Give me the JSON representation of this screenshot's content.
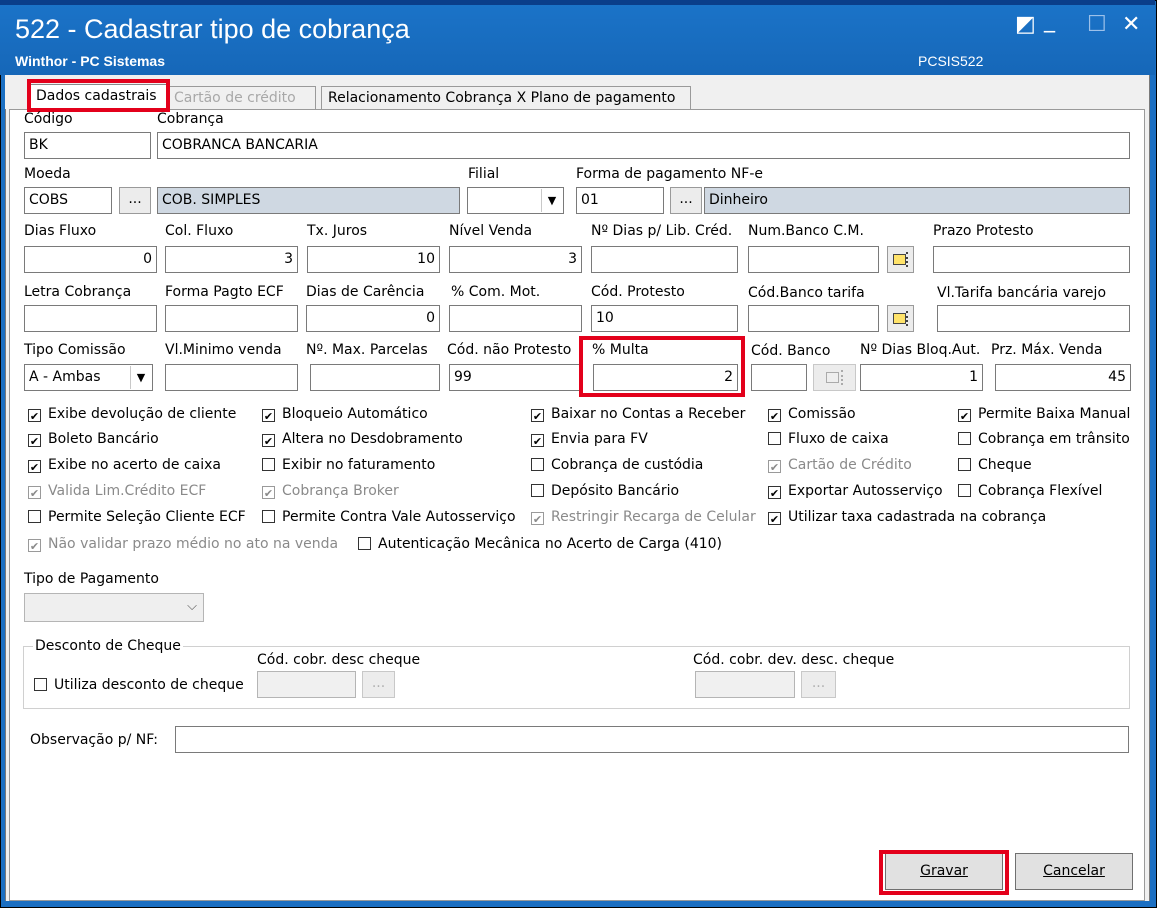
{
  "window": {
    "title": "522 - Cadastrar tipo de cobrança",
    "subtitle": "Winthor - PC Sistemas",
    "code": "PCSIS522",
    "controls": {
      "restore": "◩",
      "minimize": "_",
      "maximize": "☐",
      "close": "✕"
    }
  },
  "tabs": [
    {
      "label": "Dados cadastrais",
      "state": "active"
    },
    {
      "label": "Cartão de crédito",
      "state": "disabled"
    },
    {
      "label": "Relacionamento Cobrança X Plano de pagamento",
      "state": "normal"
    }
  ],
  "fields": {
    "codigo": {
      "label": "Código",
      "value": "BK"
    },
    "cobranca": {
      "label": "Cobrança",
      "value": "COBRANCA BANCARIA"
    },
    "moeda": {
      "label": "Moeda",
      "value": "COBS",
      "desc": "COB. SIMPLES",
      "lookup": "..."
    },
    "filial": {
      "label": "Filial",
      "value": ""
    },
    "forma_pag_nfe": {
      "label": "Forma de pagamento NF-e",
      "value": "01",
      "desc": "Dinheiro",
      "lookup": "..."
    },
    "dias_fluxo": {
      "label": "Dias Fluxo",
      "value": "0"
    },
    "col_fluxo": {
      "label": "Col. Fluxo",
      "value": "3"
    },
    "tx_juros": {
      "label": "Tx. Juros",
      "value": "10"
    },
    "nivel_venda": {
      "label": "Nível Venda",
      "value": "3"
    },
    "dias_lib_cred": {
      "label": "Nº Dias p/ Lib. Créd.",
      "value": ""
    },
    "num_banco_cm": {
      "label": "Num.Banco C.M.",
      "value": ""
    },
    "prazo_protesto": {
      "label": "Prazo Protesto",
      "value": ""
    },
    "letra_cobranca": {
      "label": "Letra Cobrança",
      "value": ""
    },
    "forma_pagto_ecf": {
      "label": "Forma Pagto ECF",
      "value": ""
    },
    "dias_carencia": {
      "label": "Dias de Carência",
      "value": "0"
    },
    "com_mot": {
      "label": "% Com. Mot.",
      "value": ""
    },
    "cod_protesto": {
      "label": "Cód. Protesto",
      "value": "10"
    },
    "cod_banco_tarifa": {
      "label": "Cód.Banco tarifa",
      "value": ""
    },
    "vl_tarifa": {
      "label": "Vl.Tarifa bancária varejo",
      "value": ""
    },
    "tipo_comissao": {
      "label": "Tipo Comissão",
      "value": "A - Ambas"
    },
    "vl_minimo_venda": {
      "label": "Vl.Minimo venda",
      "value": ""
    },
    "max_parcelas": {
      "label": "Nº. Max. Parcelas",
      "value": ""
    },
    "cod_nao_protesto": {
      "label": "Cód. não Protesto",
      "value": "99"
    },
    "multa": {
      "label": "% Multa",
      "value": "2"
    },
    "cod_banco": {
      "label": "Cód. Banco",
      "value": ""
    },
    "dias_bloq_aut": {
      "label": "Nº Dias Bloq.Aut.",
      "value": "1"
    },
    "prz_max_venda": {
      "label": "Prz. Máx. Venda",
      "value": "45"
    }
  },
  "checkboxes": [
    {
      "label": "Exibe devolução de cliente",
      "checked": true,
      "disabled": false
    },
    {
      "label": "Boleto Bancário",
      "checked": true,
      "disabled": false
    },
    {
      "label": "Exibe no acerto de caixa",
      "checked": true,
      "disabled": false
    },
    {
      "label": "Valida Lim.Crédito ECF",
      "checked": true,
      "disabled": true
    },
    {
      "label": "Permite Seleção Cliente ECF",
      "checked": false,
      "disabled": false
    },
    {
      "label": "Não validar prazo médio no ato na venda",
      "checked": true,
      "disabled": true
    },
    {
      "label": "Bloqueio Automático",
      "checked": true,
      "disabled": false
    },
    {
      "label": "Altera no Desdobramento",
      "checked": true,
      "disabled": false
    },
    {
      "label": "Exibir no faturamento",
      "checked": false,
      "disabled": false
    },
    {
      "label": "Cobrança Broker",
      "checked": true,
      "disabled": true
    },
    {
      "label": "Permite Contra Vale Autosserviço",
      "checked": false,
      "disabled": false
    },
    {
      "label": "Autenticação Mecânica no Acerto de Carga (410)",
      "checked": false,
      "disabled": false
    },
    {
      "label": "Baixar no Contas a Receber",
      "checked": true,
      "disabled": false
    },
    {
      "label": "Envia para FV",
      "checked": true,
      "disabled": false
    },
    {
      "label": "Cobrança de custódia",
      "checked": false,
      "disabled": false
    },
    {
      "label": "Depósito Bancário",
      "checked": false,
      "disabled": false
    },
    {
      "label": "Restringir Recarga de Celular",
      "checked": true,
      "disabled": true
    },
    {
      "label": "Comissão",
      "checked": true,
      "disabled": false
    },
    {
      "label": "Fluxo de caixa",
      "checked": false,
      "disabled": false
    },
    {
      "label": "Cartão de Crédito",
      "checked": true,
      "disabled": true
    },
    {
      "label": "Exportar Autosserviço",
      "checked": true,
      "disabled": false
    },
    {
      "label": "Utilizar taxa cadastrada na cobrança",
      "checked": true,
      "disabled": false
    },
    {
      "label": "Permite Baixa Manual",
      "checked": true,
      "disabled": false
    },
    {
      "label": "Cobrança em trânsito",
      "checked": false,
      "disabled": false
    },
    {
      "label": "Cheque",
      "checked": false,
      "disabled": false
    },
    {
      "label": "Cobrança Flexível",
      "checked": false,
      "disabled": false
    }
  ],
  "tipo_pagamento": {
    "label": "Tipo de Pagamento",
    "value": ""
  },
  "desconto_cheque": {
    "group_label": "Desconto de Cheque",
    "utiliza_label": "Utiliza desconto de cheque",
    "cod_cobr_label": "Cód. cobr. desc cheque",
    "cod_dev_label": "Cód. cobr. dev. desc. cheque",
    "lookup": "..."
  },
  "observacao": {
    "label": "Observação p/ NF:",
    "value": ""
  },
  "buttons": {
    "gravar": "Gravar",
    "cancelar": "Cancelar"
  },
  "colors": {
    "titlebar": "#1b6fc2",
    "highlight": "#e3001b",
    "readonly_bg": "#cfd8e2"
  }
}
